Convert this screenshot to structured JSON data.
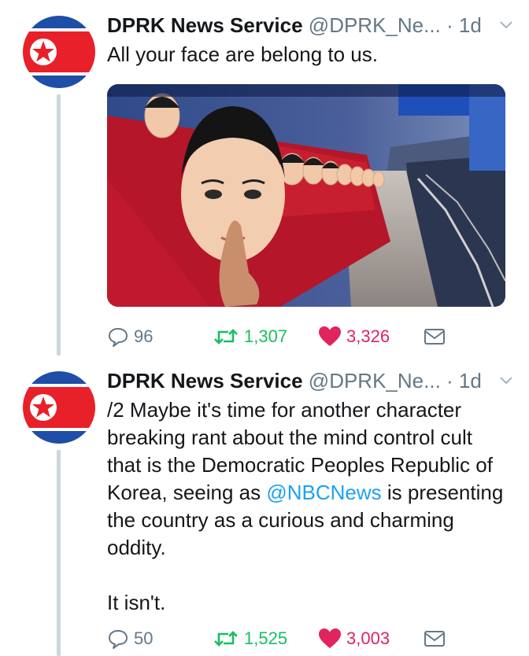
{
  "colors": {
    "text": "#14171a",
    "secondary": "#657786",
    "link": "#1da1f2",
    "retweet": "#17bf63",
    "like": "#e0245e"
  },
  "tweets": [
    {
      "name": "DPRK News Service",
      "handle": "@DPRK_Ne...",
      "time": "· 1d",
      "text": "All your face are belong to us.",
      "has_photo": true,
      "replies": "96",
      "retweets": "1,307",
      "likes": "3,326",
      "icons": [
        "reply-icon",
        "retweet-icon",
        "heart-icon",
        "envelope-icon"
      ]
    },
    {
      "name": "DPRK News Service",
      "handle": "@DPRK_Ne...",
      "time": "· 1d",
      "text_before": "/2 Maybe it's time for another character breaking rant about the mind control cult that is the Democratic Peoples Republic of Korea, seeing as ",
      "mention": "@NBCNews",
      "text_after": " is presenting the country as a curious and charming oddity.\n\nIt isn't.",
      "replies": "50",
      "retweets": "1,525",
      "likes": "3,003",
      "icons": [
        "reply-icon",
        "retweet-icon",
        "heart-icon",
        "envelope-icon"
      ]
    }
  ]
}
